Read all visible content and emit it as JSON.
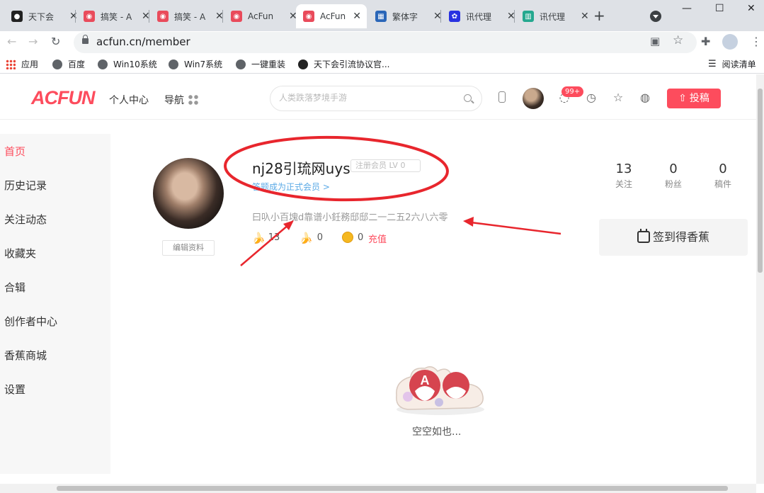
{
  "browser": {
    "tabs": [
      {
        "title": "天下会",
        "favicon_color": "#222222",
        "active": false
      },
      {
        "title": "搞笑 - A",
        "favicon_color": "#e94b5b",
        "active": false
      },
      {
        "title": "搞笑 - A",
        "favicon_color": "#e94b5b",
        "active": false
      },
      {
        "title": "AcFun",
        "favicon_color": "#e94b5b",
        "active": false
      },
      {
        "title": "AcFun",
        "favicon_color": "#e94b5b",
        "active": true
      },
      {
        "title": "繁体字",
        "favicon_color": "#2a66b8",
        "active": false
      },
      {
        "title": "讯代理",
        "favicon_color": "#2932e1",
        "active": false
      },
      {
        "title": "讯代理",
        "favicon_color": "#25a88f",
        "active": false
      }
    ],
    "new_tab_icon": "plus-icon",
    "url": "acfun.cn/member",
    "bookmarks": [
      {
        "label": "应用",
        "icon": "apps-grid-icon"
      },
      {
        "label": "百度",
        "icon": "globe-icon"
      },
      {
        "label": "Win10系统",
        "icon": "globe-icon"
      },
      {
        "label": "Win7系统",
        "icon": "globe-icon"
      },
      {
        "label": "一键重装",
        "icon": "globe-icon"
      },
      {
        "label": "天下会引流协议官...",
        "icon": "penguin-icon"
      }
    ],
    "reading_list": "阅读清单"
  },
  "site": {
    "logo": "ACFUN",
    "brand_color": "#fd4c5d",
    "nav": {
      "personal_center": "个人中心",
      "navigation": "导航"
    },
    "search_placeholder": "人类跌落梦境手游",
    "message_badge": "99+",
    "upload_label": "投稿"
  },
  "sidebar": {
    "items": [
      {
        "label": "首页",
        "active": true
      },
      {
        "label": "历史记录",
        "active": false
      },
      {
        "label": "关注动态",
        "active": false
      },
      {
        "label": "收藏夹",
        "active": false
      },
      {
        "label": "合辑",
        "active": false
      },
      {
        "label": "创作者中心",
        "active": false
      },
      {
        "label": "香蕉商城",
        "active": false
      },
      {
        "label": "设置",
        "active": false
      }
    ]
  },
  "profile": {
    "username": "nj28引琉网uys",
    "level": "注册会员 LV 0",
    "become_member_link": "答题成为正式会员 >",
    "signature": "曰叺小百塊d靠谱小鈓務邸邸二一二五2六八六零",
    "edit_button": "编辑资料",
    "bananas": "13",
    "gold_bananas": "0",
    "acoins": "0",
    "recharge": "充值",
    "stats": [
      {
        "count": "13",
        "label": "关注"
      },
      {
        "count": "0",
        "label": "粉丝"
      },
      {
        "count": "0",
        "label": "稿件"
      }
    ],
    "checkin_label": "签到得香蕉"
  },
  "empty_state": {
    "text": "空空如也..."
  },
  "annotation_color": "#e8262d"
}
